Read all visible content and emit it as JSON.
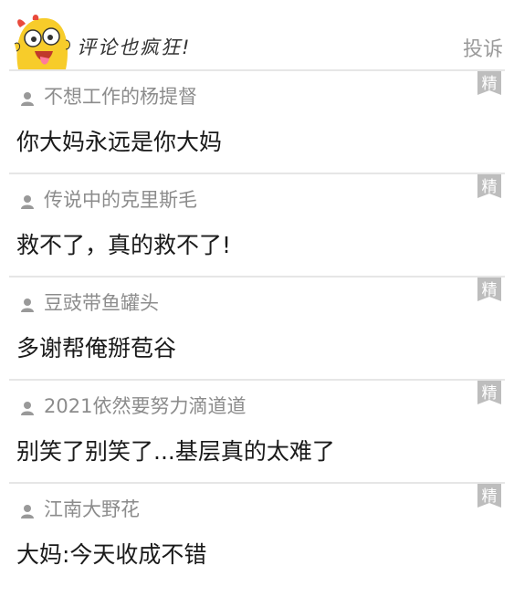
{
  "header": {
    "title": "评论也疯狂!",
    "report_label": "投诉"
  },
  "badge_label": "精",
  "comments": [
    {
      "user": "不想工作的杨提督",
      "text": "你大妈永远是你大妈"
    },
    {
      "user": "传说中的克里斯毛",
      "text": "救不了，真的救不了!"
    },
    {
      "user": "豆豉带鱼罐头",
      "text": "多谢帮俺掰苞谷"
    },
    {
      "user": "2021依然要努力滴道道",
      "text": "别笑了别笑了...基层真的太难了"
    },
    {
      "user": "江南大野花",
      "text": "大妈:今天收成不错"
    }
  ],
  "colors": {
    "badge": "#bdbdbd",
    "mascot": "#f7cc2a",
    "divider": "#e6e6e6"
  }
}
